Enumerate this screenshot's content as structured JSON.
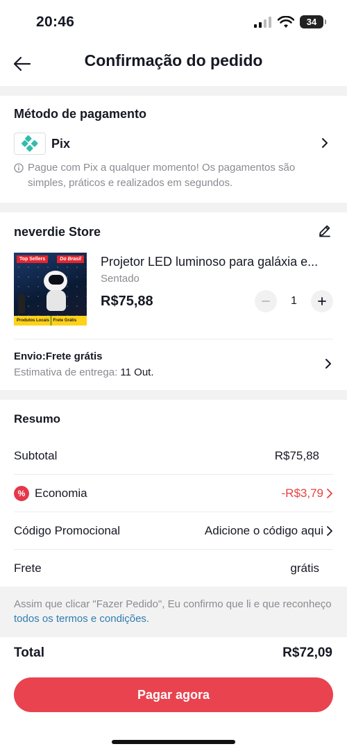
{
  "status_bar": {
    "time": "20:46",
    "battery": "34"
  },
  "header": {
    "title": "Confirmação do pedido"
  },
  "payment": {
    "section_title": "Método de pagamento",
    "method": "Pix",
    "note": "Pague com Pix a qualquer momento! Os pagamentos são simples, práticos e realizados em segundos."
  },
  "store": {
    "name": "neverdie Store",
    "product": {
      "name": "Projetor LED luminoso para galáxia e...",
      "variant": "Sentado",
      "price": "R$75,88",
      "quantity": "1",
      "image_tags": {
        "top_left": "Top Sellers",
        "top_right": "Do Brasil",
        "bottom_left": "Produtos Locais",
        "bottom_right": "Frete Grátis"
      }
    },
    "shipping": {
      "title": "Envio:Frete grátis",
      "eta_label": "Estimativa de entrega: ",
      "eta_date": "11 Out."
    }
  },
  "summary": {
    "section_title": "Resumo",
    "rows": [
      {
        "label": "Subtotal",
        "value": "R$75,88"
      },
      {
        "label": "Economia",
        "value": "-R$3,79"
      },
      {
        "label": "Código Promocional",
        "value": "Adicione o código aqui"
      },
      {
        "label": "Frete",
        "value": "grátis"
      }
    ]
  },
  "terms": {
    "text": "Assim que clicar \"Fazer Pedido\", Eu confirmo que li e que reconheço ",
    "link": "todos os termos e condições."
  },
  "footer": {
    "total_label": "Total",
    "total_value": "R$72,09",
    "pay_button": "Pagar agora"
  },
  "colors": {
    "accent": "#e8434f",
    "discount": "#e9413f",
    "link": "#2e7db1",
    "pix": "#32bcad"
  }
}
